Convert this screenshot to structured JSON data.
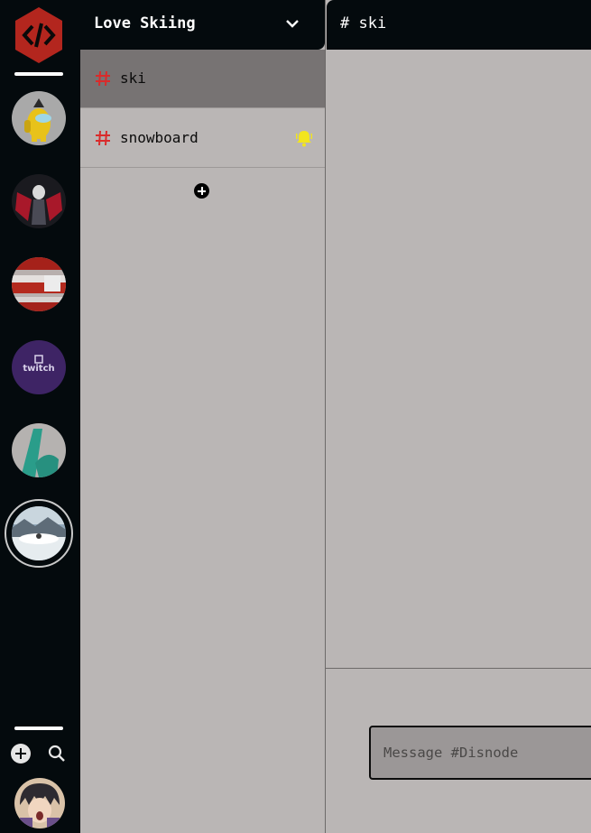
{
  "server": {
    "name": "Love Skiing",
    "channels": [
      {
        "label": "ski",
        "active": true,
        "notification": false
      },
      {
        "label": "snowboard",
        "active": false,
        "notification": true
      }
    ]
  },
  "chat": {
    "title": "# ski",
    "input_placeholder": "Message #Disnode"
  },
  "rail": {
    "servers": [
      {
        "icon": "among-us-avatar-icon"
      },
      {
        "icon": "gaming-avatar-icon"
      },
      {
        "icon": "red-stripes-avatar-icon"
      },
      {
        "icon": "twitch-avatar-icon",
        "text": "twitch"
      },
      {
        "icon": "teal-letter-avatar-icon"
      },
      {
        "icon": "skiing-avatar-icon",
        "active": true
      }
    ]
  },
  "colors": {
    "dark": "#040a0d",
    "panel": "#bab6b5",
    "active_channel": "#777373",
    "hash": "#d92b2b",
    "bell": "#f2e51d",
    "logo": "#b3261e"
  }
}
